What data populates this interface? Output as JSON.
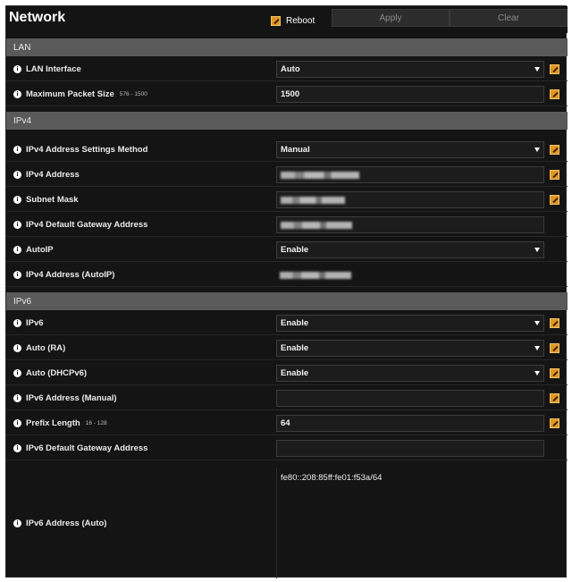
{
  "header": {
    "title": "Network",
    "reboot_label": "Reboot",
    "apply_label": "Apply",
    "clear_label": "Clear"
  },
  "sections": {
    "lan": "LAN",
    "ipv4": "IPv4",
    "ipv6": "IPv6"
  },
  "lan": {
    "interface": {
      "label": "LAN Interface",
      "value": "Auto"
    },
    "packet_size": {
      "label": "Maximum Packet Size",
      "range": "576 - 1500",
      "value": "1500"
    }
  },
  "ipv4": {
    "method": {
      "label": "IPv4 Address Settings Method",
      "value": "Manual"
    },
    "address": {
      "label": "IPv4 Address"
    },
    "subnet": {
      "label": "Subnet Mask"
    },
    "gateway": {
      "label": "IPv4 Default Gateway Address"
    },
    "autoip": {
      "label": "AutoIP",
      "value": "Enable"
    },
    "autoip_address": {
      "label": "IPv4 Address (AutoIP)"
    }
  },
  "ipv6": {
    "enable": {
      "label": "IPv6",
      "value": "Enable"
    },
    "auto_ra": {
      "label": "Auto (RA)",
      "value": "Enable"
    },
    "auto_dhcp": {
      "label": "Auto (DHCPv6)",
      "value": "Enable"
    },
    "manual_address": {
      "label": "IPv6 Address (Manual)",
      "value": ""
    },
    "prefix": {
      "label": "Prefix Length",
      "range": "16 - 128",
      "value": "64"
    },
    "gateway": {
      "label": "IPv6 Default Gateway Address",
      "value": ""
    },
    "auto_address": {
      "label": "IPv6 Address (Auto)",
      "value": "fe80::208:85ff:fe01:f53a/64"
    }
  },
  "icons": {
    "edit": "pencil-edit-icon",
    "info": "info-icon",
    "dropdown": "chevron-down-icon"
  },
  "colors": {
    "panel_bg": "#141414",
    "section_bg": "#5a5a5a",
    "edit_accent": "#e09624"
  }
}
